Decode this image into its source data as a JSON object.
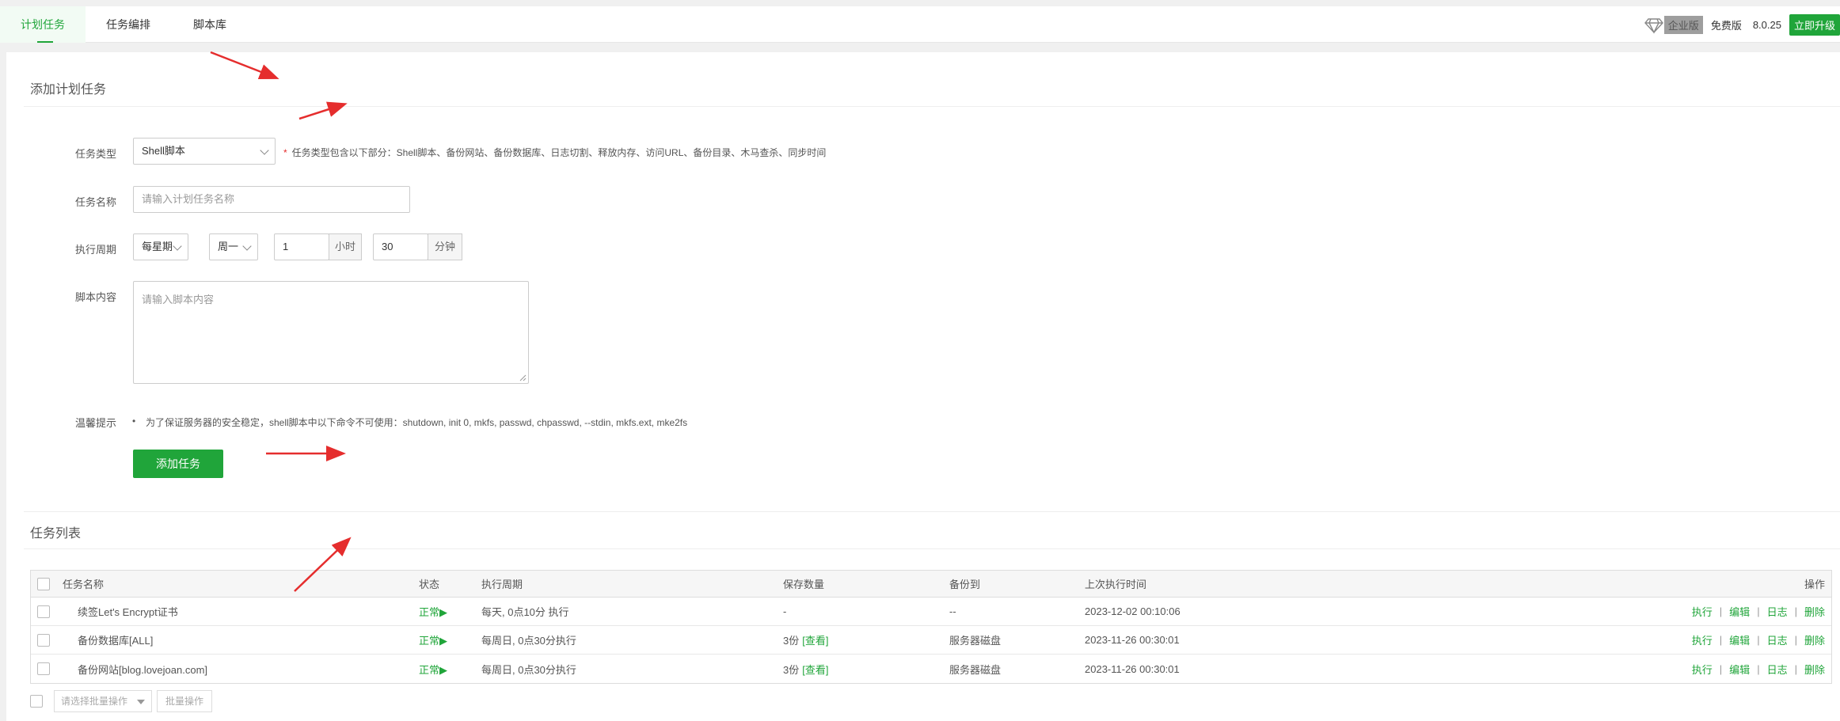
{
  "tabs": [
    {
      "label": "计划任务",
      "active": true
    },
    {
      "label": "任务编排",
      "active": false
    },
    {
      "label": "脚本库",
      "active": false
    }
  ],
  "topright": {
    "edition_badge": "企业版",
    "version_type": "免费版",
    "version": "8.0.25",
    "upgrade": "立即升级"
  },
  "form": {
    "title": "添加计划任务",
    "task_type_label": "任务类型",
    "task_type_value": "Shell脚本",
    "task_type_hint_star": "*",
    "task_type_hint": "任务类型包含以下部分：Shell脚本、备份网站、备份数据库、日志切割、释放内存、访问URL、备份目录、木马查杀、同步时间",
    "task_name_label": "任务名称",
    "task_name_placeholder": "请输入计划任务名称",
    "period_label": "执行周期",
    "period_value": "每星期",
    "weekday_value": "周一",
    "hour_value": "1",
    "hour_unit": "小时",
    "minute_value": "30",
    "minute_unit": "分钟",
    "script_label": "脚本内容",
    "script_placeholder": "请输入脚本内容",
    "tip_label": "温馨提示",
    "tip_bullet": "•",
    "tip_text": "为了保证服务器的安全稳定，shell脚本中以下命令不可使用：shutdown, init 0, mkfs, passwd, chpasswd, --stdin, mkfs.ext, mke2fs",
    "submit": "添加任务"
  },
  "list": {
    "title": "任务列表",
    "headers": {
      "name": "任务名称",
      "status": "状态",
      "period": "执行周期",
      "keep": "保存数量",
      "backup_to": "备份到",
      "last_run": "上次执行时间",
      "ops": "操作"
    },
    "rows": [
      {
        "name": "续签Let's Encrypt证书",
        "status": "正常▶",
        "period": "每天, 0点10分 执行",
        "keep": "-",
        "keep_link": "",
        "backup_to": "--",
        "last_run": "2023-12-02 00:10:06"
      },
      {
        "name": "备份数据库[ALL]",
        "status": "正常▶",
        "period": "每周日, 0点30分执行",
        "keep": "3份",
        "keep_link": "[查看]",
        "backup_to": "服务器磁盘",
        "last_run": "2023-11-26 00:30:01"
      },
      {
        "name": "备份网站[blog.lovejoan.com]",
        "status": "正常▶",
        "period": "每周日, 0点30分执行",
        "keep": "3份",
        "keep_link": "[查看]",
        "backup_to": "服务器磁盘",
        "last_run": "2023-11-26 00:30:01"
      }
    ],
    "ops": {
      "run": "执行",
      "edit": "编辑",
      "log": "日志",
      "delete": "删除",
      "sep": "|"
    },
    "batch_placeholder": "请选择批量操作",
    "batch_button": "批量操作"
  },
  "colors": {
    "accent": "#20a53a",
    "annotation": "#e52d2d"
  }
}
